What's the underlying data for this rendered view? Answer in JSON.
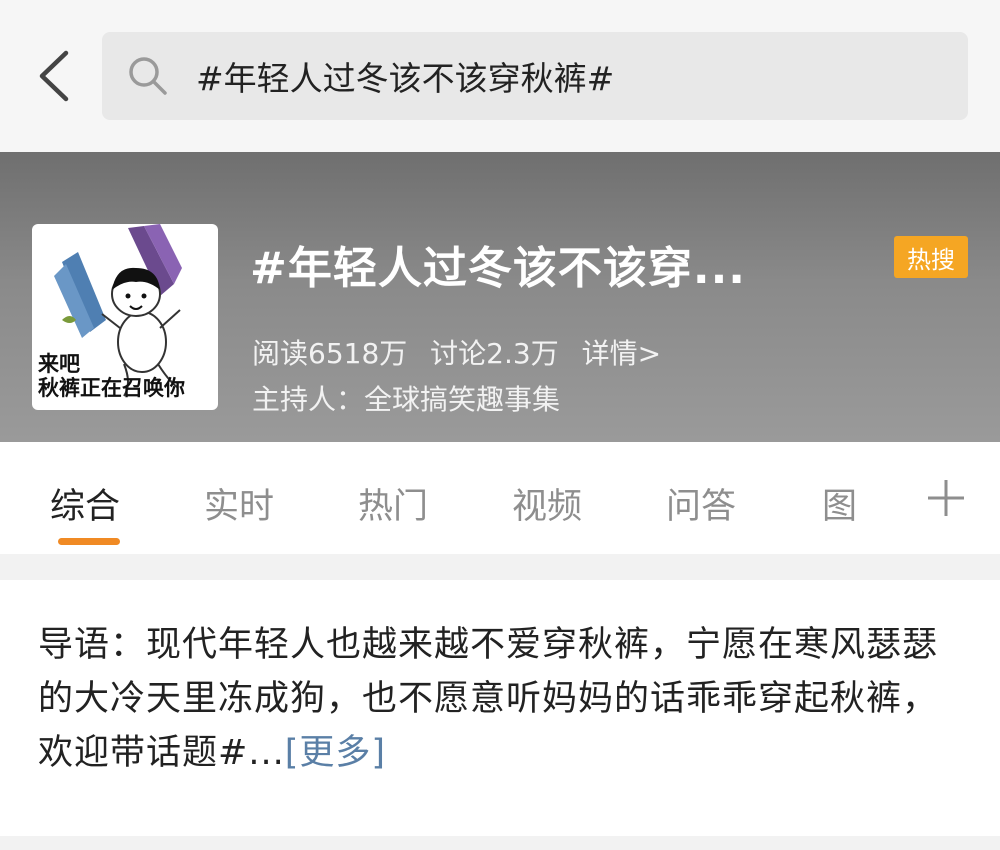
{
  "search": {
    "query": "#年轻人过冬该不该穿秋裤#"
  },
  "topic": {
    "thumbnail_caption_line1": "来吧",
    "thumbnail_caption_line2": "秋裤正在召唤你",
    "title": "#年轻人过冬该不该穿...",
    "badge": "热搜",
    "reads": "阅读6518万",
    "discussions": "讨论2.3万",
    "details": "详情>",
    "host": "主持人：全球搞笑趣事集"
  },
  "tabs": [
    {
      "label": "综合"
    },
    {
      "label": "实时"
    },
    {
      "label": "热门"
    },
    {
      "label": "视频"
    },
    {
      "label": "问答"
    },
    {
      "label": "图"
    }
  ],
  "intro": {
    "text": "导语：现代年轻人也越来越不爱穿秋裤，宁愿在寒风瑟瑟的大冷天里冻成狗，也不愿意听妈妈的话乖乖穿起秋裤，欢迎带话题#...",
    "more": "[更多]"
  },
  "colors": {
    "accent": "#f08a24",
    "badge": "#f5a623",
    "link": "#5a7fa6"
  },
  "icons": [
    "back-arrow-icon",
    "search-icon",
    "plus-icon"
  ]
}
